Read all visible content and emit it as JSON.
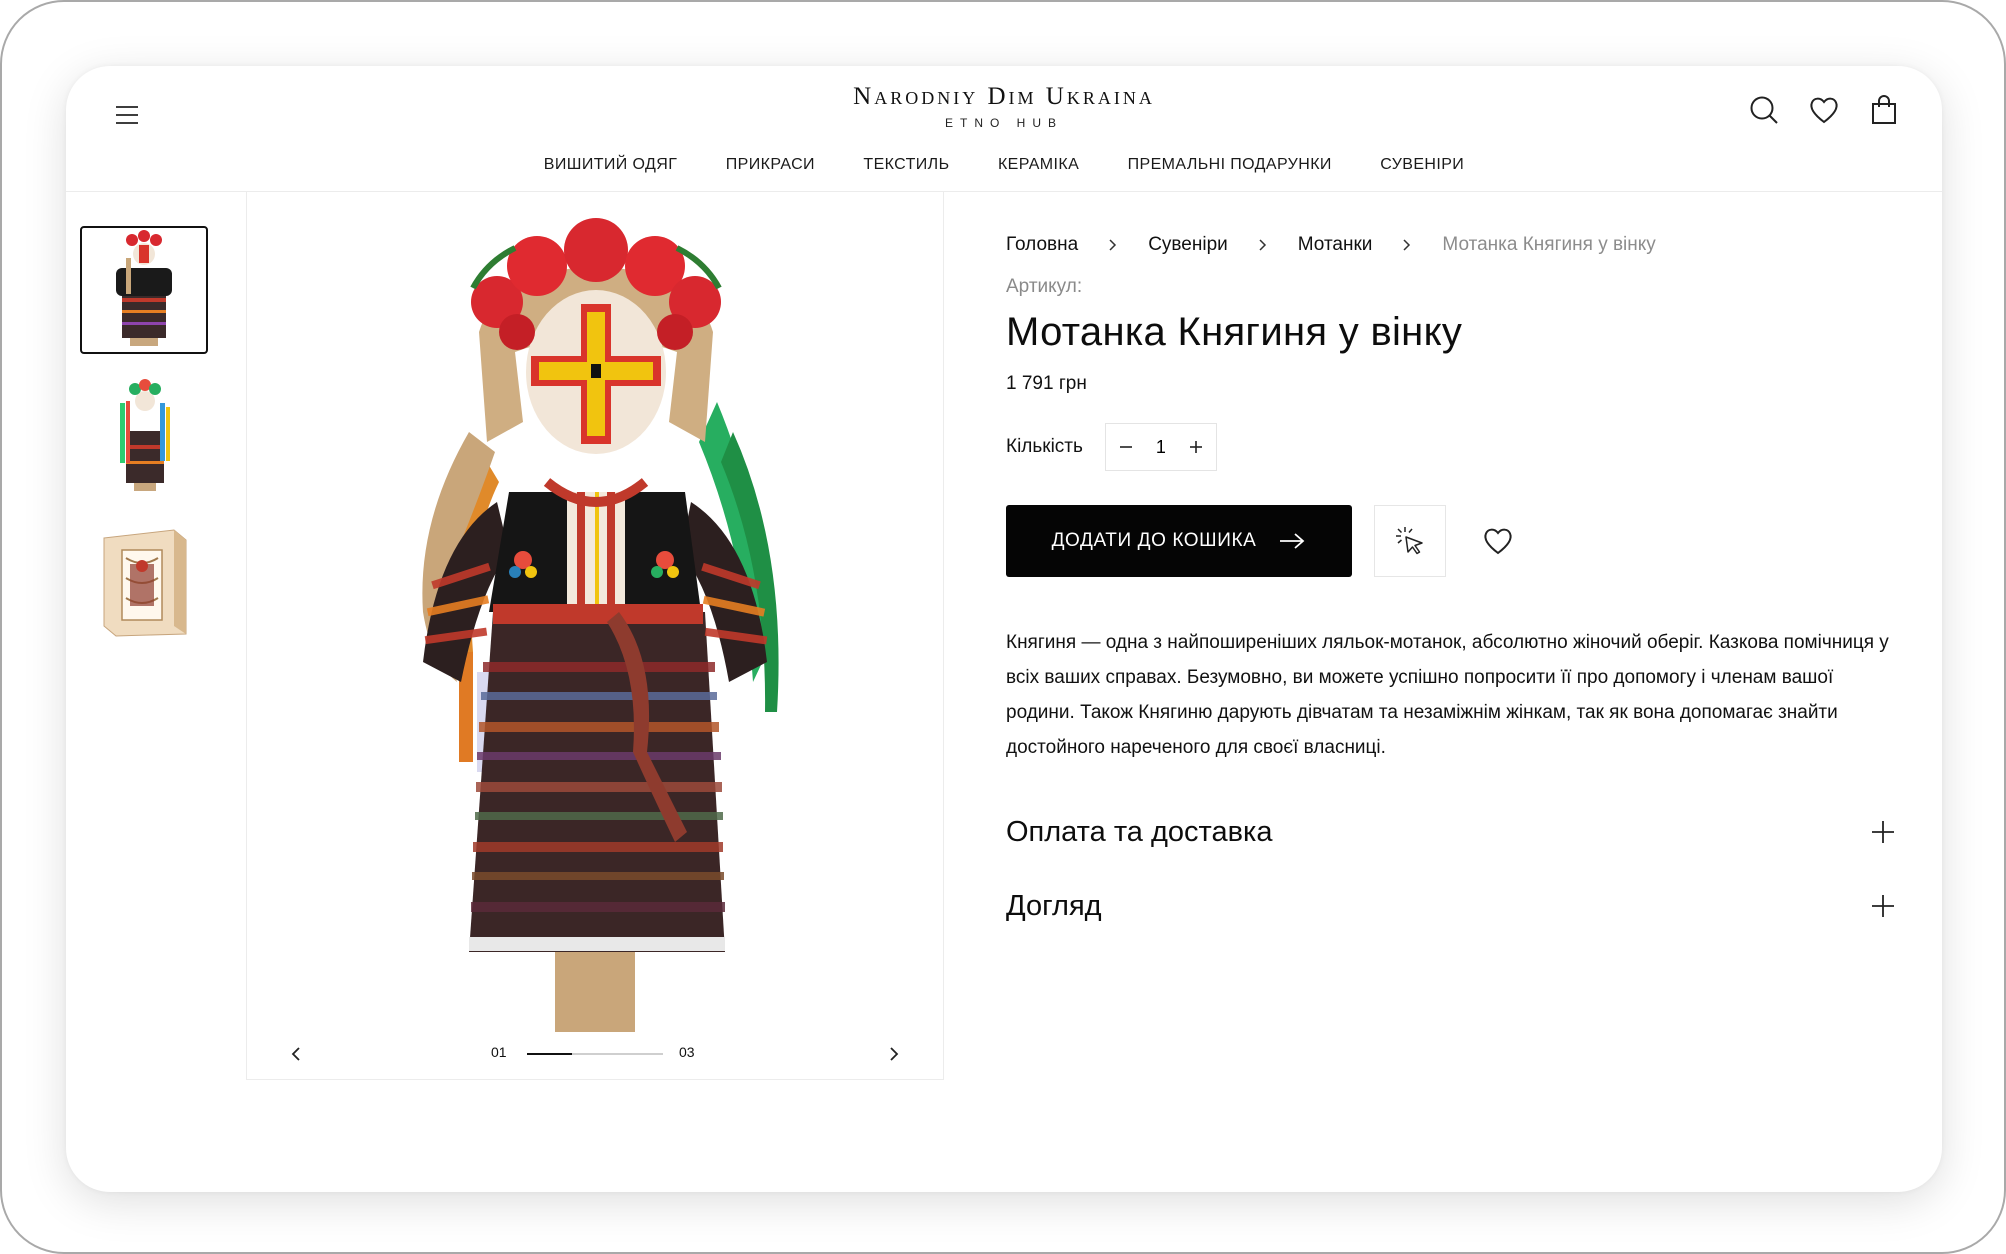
{
  "brand": {
    "title": "Narodniy Dim Ukraina",
    "subtitle": "ETNO HUB"
  },
  "nav": [
    "ВИШИТИЙ ОДЯГ",
    "ПРИКРАСИ",
    "ТЕКСТИЛЬ",
    "КЕРАМІКА",
    "ПРЕМАЛЬНІ ПОДАРУНКИ",
    "СУВЕНІРИ"
  ],
  "header_icons": [
    "menu-icon",
    "search-icon",
    "heart-icon",
    "bag-icon"
  ],
  "gallery": {
    "current": "01",
    "total": "03",
    "progress": 0.33,
    "thumbnails": [
      "motanka-front",
      "motanka-ribbons",
      "motanka-box"
    ]
  },
  "breadcrumb": [
    "Головна",
    "Сувеніри",
    "Мотанки",
    "Мотанка Княгиня у вінку"
  ],
  "product": {
    "article_label": "Артикул:",
    "title": "Мотанка Княгиня у вінку",
    "price": "1 791 грн",
    "quantity_label": "Кількість",
    "quantity": "1",
    "add_to_cart": "ДОДАТИ ДО КОШИКА",
    "description": "Княгиня — одна з найпоширеніших ляльок-мотанок, абсолютно жіночий оберіг. Казкова помічниця у всіх ваших справах. Безумовно, ви можете успішно попросити її про допомогу і членам вашої родини. Також Княгиню дарують дівчатам та незаміжнім жінкам, так як вона допомагає знайти достойного нареченого для своєї власниці."
  },
  "accordion": [
    "Оплата та доставка",
    "Догляд"
  ],
  "colors": {
    "button": "#050505",
    "muted": "#8c8c8c",
    "border": "#e4e4e4"
  }
}
